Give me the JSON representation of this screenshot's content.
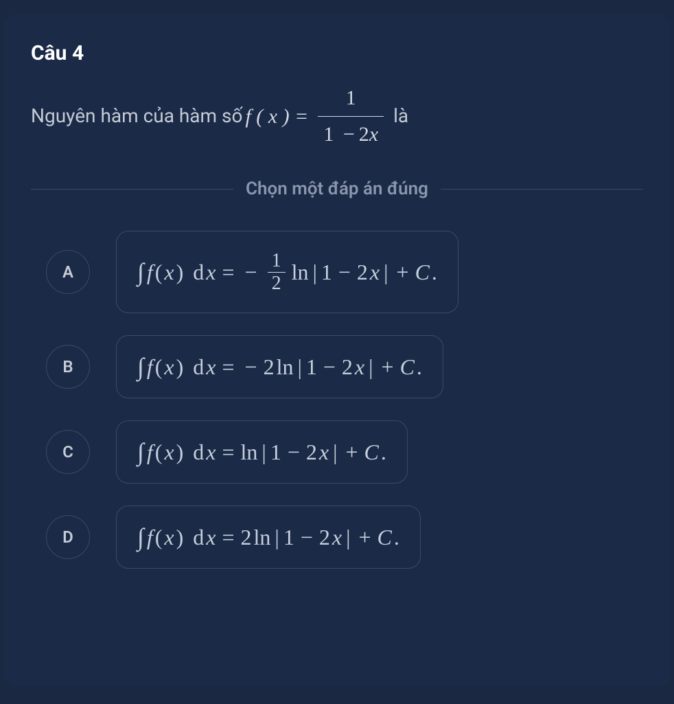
{
  "question": {
    "title": "Câu 4",
    "prompt_prefix": "Nguyên hàm của hàm số ",
    "prompt_suffix": " là",
    "function_lhs": "f ( x ) =",
    "fraction_num": "1",
    "fraction_den_prefix": "1",
    "fraction_den_op": "−",
    "fraction_den_coef": "2",
    "fraction_den_var": "x"
  },
  "instruction": "Chọn một đáp án đúng",
  "math": {
    "integral": "∫",
    "fx": "f",
    "paren_l": "(",
    "paren_r": ")",
    "x": "x",
    "d": "d",
    "eq": "=",
    "minus": "−",
    "plus": "+",
    "ln": "ln",
    "abs": "|",
    "one": "1",
    "two": "2",
    "C": "C",
    "period": "."
  },
  "options": [
    {
      "letter": "A",
      "type": "frac_neg_half"
    },
    {
      "letter": "B",
      "type": "neg_two"
    },
    {
      "letter": "C",
      "type": "plain"
    },
    {
      "letter": "D",
      "type": "pos_two"
    }
  ]
}
